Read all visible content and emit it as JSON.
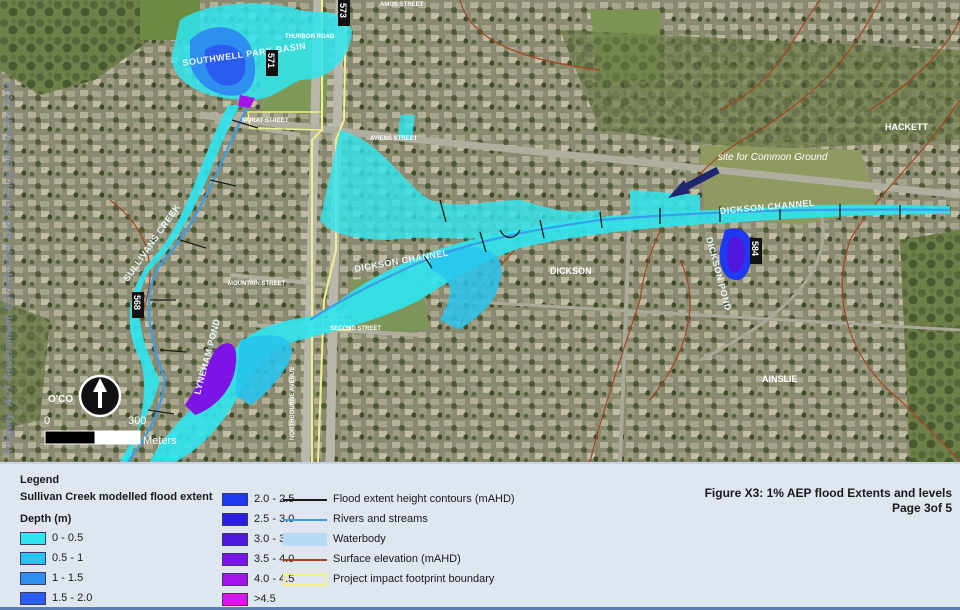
{
  "map": {
    "place_labels": [
      "HACKETT",
      "DICKSON",
      "AINSLIE"
    ],
    "annotation": "site for Common Ground",
    "water_labels": [
      "SOUTHWELL PARK BASIN",
      "SULLIVANS CREEK",
      "DICKSON CHANNEL",
      "DICKSON CHANNEL",
      "DICKSON POND",
      "LYNEHAM POND"
    ],
    "road_labels": [
      "THURBON ROAD",
      "MURAT STREET",
      "AVIENS STREET",
      "MOUNTAIN STREET",
      "SECOND STREET",
      "NORTHBOURNE AVENUE",
      "AMOS STREET"
    ],
    "contour_values": [
      "573",
      "571",
      "568",
      "584"
    ],
    "credit": "Imagery: ACT Government, Environment and Planning Directorate 2014"
  },
  "scalebar": {
    "north_label": "O'CO",
    "ticks": [
      "0",
      "300"
    ],
    "unit": "Meters"
  },
  "legend": {
    "title": "Legend",
    "subtitle": "Sullivan Creek modelled flood extent",
    "depth_heading": "Depth (m)",
    "depth_classes": [
      {
        "label": "0 - 0.5",
        "color": "#2ee6ef"
      },
      {
        "label": "0.5 - 1",
        "color": "#27c4ee"
      },
      {
        "label": "1 - 1.5",
        "color": "#2f8ff0"
      },
      {
        "label": "1.5 - 2.0",
        "color": "#2a5cf0"
      },
      {
        "label": "2.0 - 2.5",
        "color": "#1f38f2"
      },
      {
        "label": "2.5 - 3.0",
        "color": "#2a1fe0"
      },
      {
        "label": "3.0 - 3.5",
        "color": "#5016dc"
      },
      {
        "label": "3.5 - 4.0",
        "color": "#7d14e6"
      },
      {
        "label": "4.0 - 4.5",
        "color": "#a414ea"
      },
      {
        "label": ">4.5",
        "color": "#dc14ea"
      }
    ],
    "other_items": [
      {
        "label": "Flood extent height contours (mAHD)",
        "kind": "line",
        "color": "#1a1a1a"
      },
      {
        "label": "Rivers and streams",
        "kind": "line",
        "color": "#3a9ee8"
      },
      {
        "label": "Waterbody",
        "kind": "fill",
        "color": "#b6dcf6"
      },
      {
        "label": "Surface elevation (mAHD)",
        "kind": "line",
        "color": "#a5431f"
      },
      {
        "label": "Project impact footprint boundary",
        "kind": "box",
        "color": "#f0f08c"
      }
    ]
  },
  "figure": {
    "title": "Figure X3: 1% AEP flood Extents and levels",
    "page": "Page 3of 5"
  }
}
